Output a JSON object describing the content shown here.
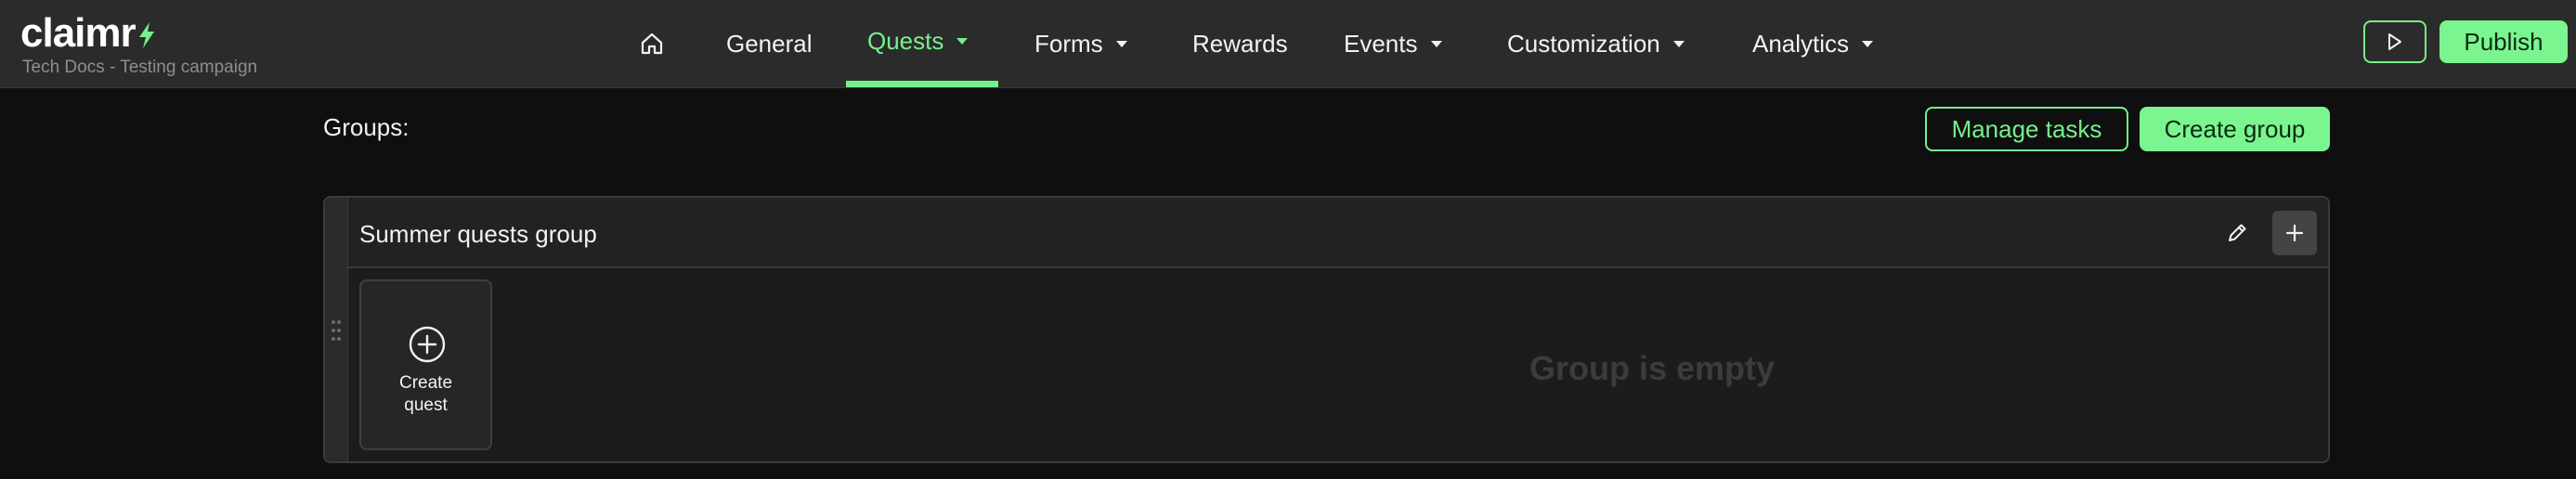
{
  "header": {
    "logo_text": "claimr",
    "subtitle": "Tech Docs - Testing campaign",
    "publish_label": "Publish",
    "accent_color": "#76f08a"
  },
  "nav": {
    "items": [
      {
        "label": "General"
      },
      {
        "label": "Quests",
        "active": true
      },
      {
        "label": "Forms"
      },
      {
        "label": "Rewards"
      },
      {
        "label": "Events"
      },
      {
        "label": "Customization"
      },
      {
        "label": "Analytics"
      }
    ]
  },
  "main": {
    "groups_label": "Groups:",
    "manage_tasks_label": "Manage tasks",
    "create_group_label": "Create group",
    "group": {
      "title": "Summer quests group",
      "create_quest_label": "Create quest",
      "empty_text": "Group is empty"
    }
  }
}
